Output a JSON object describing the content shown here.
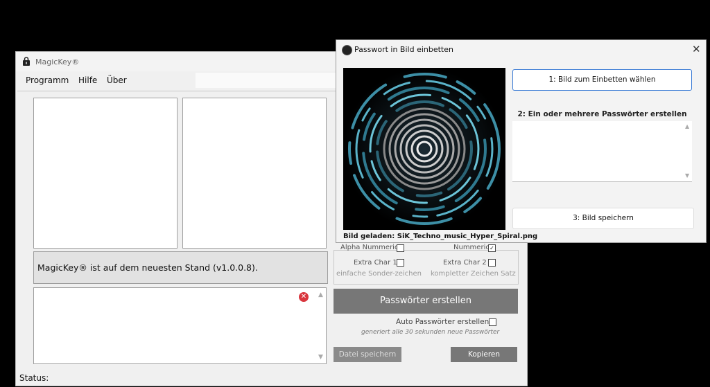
{
  "main_window": {
    "title": "MagicKey®",
    "menu": [
      "Programm",
      "Hilfe",
      "Über"
    ],
    "update_message": "MagicKey® ist auf dem neuesten Stand (v1.0.0.8).",
    "options": {
      "alpha_numeric": "Alpha Nummeric",
      "numeric": "Nummeric",
      "extra_char_1": "Extra Char 1:",
      "extra_char_1_sub": "einfache Sonder-zeichen",
      "extra_char_2": "Extra Char 2 :",
      "extra_char_2_sub": "kompletter Zeichen Satz"
    },
    "create_button": "Passwörter erstellen",
    "auto_label": "Auto Passwörter erstellen",
    "auto_sub": "generiert alle 30 sekunden neue Passwörter",
    "save_file_button": "Datei speichern",
    "copy_button": "Kopieren",
    "status_label": "Status:"
  },
  "dialog": {
    "title": "Passwort in Bild einbetten",
    "choose_image_button": "1: Bild zum Einbetten wählen",
    "create_passwords_label": "2: Ein oder mehrere Passwörter erstellen",
    "save_image_button": "3: Bild speichern",
    "image_caption": "Bild geladen: SiK_Techno_music_Hyper_Spiral.png"
  },
  "icons": {
    "lock": "lock-icon",
    "error": "error-icon",
    "close": "close-icon",
    "app": "app-icon"
  },
  "colors": {
    "dark_button": "#777777",
    "accent_border": "#3a7bd5",
    "error": "#d9363e"
  }
}
